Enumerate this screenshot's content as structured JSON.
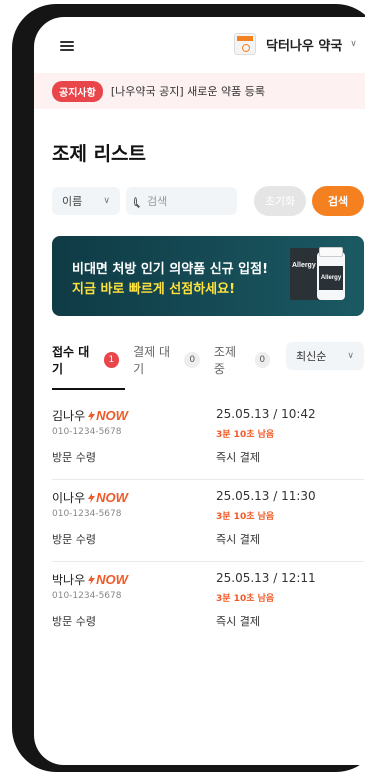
{
  "header": {
    "store_name": "닥터나우 약국"
  },
  "notice": {
    "badge": "공지사항",
    "text": "[나우약국 공지] 새로운 약품 등록"
  },
  "page_title": "조제 리스트",
  "search": {
    "filter_selected": "이름",
    "placeholder": "검색",
    "reset_label": "초기화",
    "search_label": "검색"
  },
  "banner": {
    "line1": "비대면 처방 인기 의약품 신규 입점!",
    "line2": "지금 바로 빠르게 선점하세요!",
    "product_label": "Allergy"
  },
  "tabs": [
    {
      "label": "접수 대기",
      "count": "1"
    },
    {
      "label": "결제 대기",
      "count": "0"
    },
    {
      "label": "조제 중",
      "count": "0"
    }
  ],
  "sort": {
    "selected": "최신순"
  },
  "orders": [
    {
      "name": "김나우",
      "badge": "NOW",
      "phone": "010-1234-5678",
      "method": "방문 수령",
      "datetime": "25.05.13 / 10:42",
      "remaining": "3분 10초 남음",
      "payment": "즉시 결제"
    },
    {
      "name": "이나우",
      "badge": "NOW",
      "phone": "010-1234-5678",
      "method": "방문 수령",
      "datetime": "25.05.13 / 11:30",
      "remaining": "3분 10초 남음",
      "payment": "즉시 결제"
    },
    {
      "name": "박나우",
      "badge": "NOW",
      "phone": "010-1234-5678",
      "method": "방문 수령",
      "datetime": "25.05.13 / 12:11",
      "remaining": "3분 10초 남음",
      "payment": "즉시 결제"
    }
  ],
  "colors": {
    "accent": "#f5801f",
    "alert": "#e8464b",
    "banner_bg": "#134650",
    "banner_highlight": "#ffe23d"
  }
}
